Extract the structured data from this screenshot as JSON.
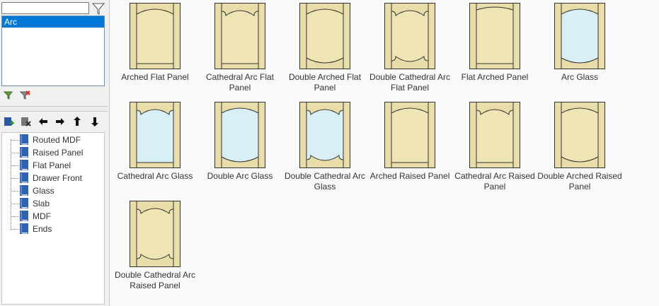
{
  "search": {
    "value": ""
  },
  "filter_list": {
    "selected": "Arc"
  },
  "tree": {
    "items": [
      "Routed MDF",
      "Raised Panel",
      "Flat Panel",
      "Drawer Front",
      "Glass",
      "Slab",
      "MDF",
      "Ends"
    ]
  },
  "doors": [
    {
      "label": "Arched Flat Panel",
      "style": "arched-top",
      "fill": "panel"
    },
    {
      "label": "Cathedral Arc Flat Panel",
      "style": "cathedral-top",
      "fill": "panel"
    },
    {
      "label": "Double Arched Flat Panel",
      "style": "double-arched",
      "fill": "panel"
    },
    {
      "label": "Double Cathedral Arc Flat Panel",
      "style": "double-cathedral",
      "fill": "panel"
    },
    {
      "label": "Flat Arched Panel",
      "style": "flat-arched",
      "fill": "panel"
    },
    {
      "label": "Arc Glass",
      "style": "arc-glass",
      "fill": "glass"
    },
    {
      "label": "Cathedral Arc Glass",
      "style": "cathedral-top",
      "fill": "glass"
    },
    {
      "label": "Double Arc Glass",
      "style": "double-arched",
      "fill": "glass"
    },
    {
      "label": "Double Cathedral Arc Glass",
      "style": "double-cathedral",
      "fill": "glass"
    },
    {
      "label": "Arched Raised Panel",
      "style": "arched-top",
      "fill": "panel"
    },
    {
      "label": "Cathedral Arc Raised Panel",
      "style": "cathedral-top",
      "fill": "panel"
    },
    {
      "label": "Double Arched Raised Panel",
      "style": "double-arched",
      "fill": "panel"
    },
    {
      "label": "Double Cathedral Arc Raised Panel",
      "style": "double-cathedral",
      "fill": "panel"
    }
  ],
  "colors": {
    "frame": "#e8dca8",
    "panel": "#efe4b4",
    "glass": "#d8eff5",
    "line": "#333333",
    "selection": "#0078d7"
  },
  "icons": {
    "filter": "funnel-icon",
    "apply_filter": "green-funnel-icon",
    "clear_filter": "red-funnel-icon",
    "add": "add-item-icon",
    "remove": "remove-item-icon",
    "left": "arrow-left-icon",
    "right": "arrow-right-icon",
    "up": "arrow-up-icon",
    "down": "arrow-down-icon",
    "book": "book-icon"
  }
}
